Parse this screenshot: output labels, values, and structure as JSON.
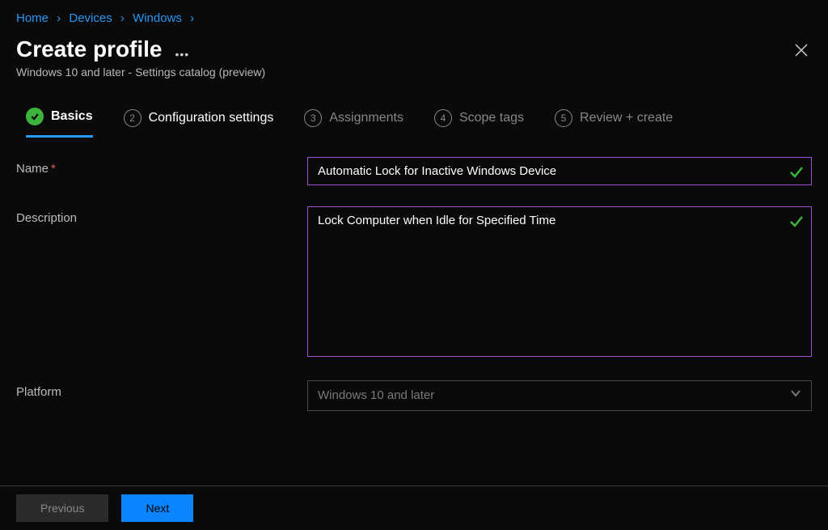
{
  "breadcrumbs": {
    "items": [
      {
        "label": "Home"
      },
      {
        "label": "Devices"
      },
      {
        "label": "Windows"
      }
    ]
  },
  "header": {
    "title": "Create profile",
    "subtitle": "Windows 10 and later - Settings catalog (preview)"
  },
  "stepper": {
    "steps": [
      {
        "num": "1",
        "label": "Basics",
        "state": "active-completed"
      },
      {
        "num": "2",
        "label": "Configuration settings",
        "state": "next"
      },
      {
        "num": "3",
        "label": "Assignments",
        "state": "future"
      },
      {
        "num": "4",
        "label": "Scope tags",
        "state": "future"
      },
      {
        "num": "5",
        "label": "Review + create",
        "state": "future"
      }
    ]
  },
  "form": {
    "name_label": "Name",
    "name_value": "Automatic Lock for Inactive Windows Device",
    "description_label": "Description",
    "description_value": "Lock Computer when Idle for Specified Time",
    "platform_label": "Platform",
    "platform_value": "Windows 10 and later"
  },
  "footer": {
    "previous_label": "Previous",
    "next_label": "Next"
  }
}
